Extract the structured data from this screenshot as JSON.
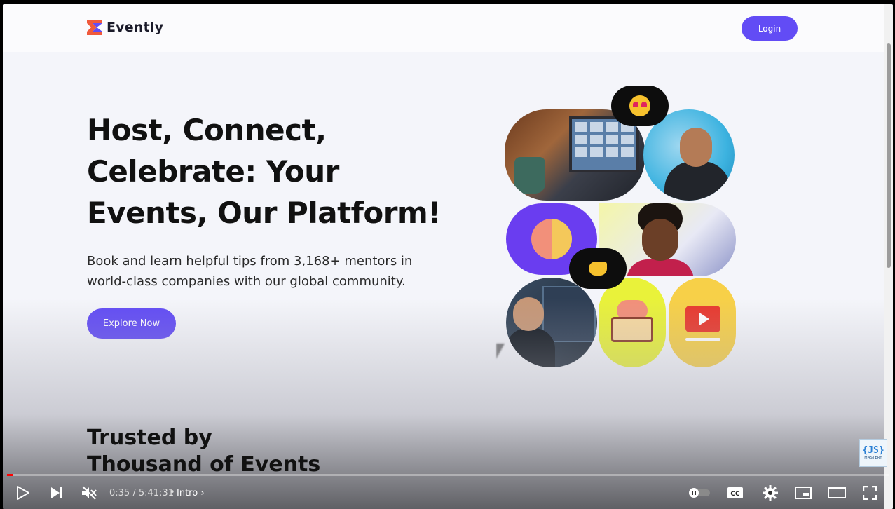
{
  "header": {
    "brand": "Evently",
    "login_label": "Login"
  },
  "hero": {
    "title": "Host, Connect, Celebrate: Your Events, Our Platform!",
    "subtitle": "Book and learn helpful tips from 3,168+ mentors in world-class companies with our global community.",
    "cta_label": "Explore Now"
  },
  "section": {
    "trusted_line1": "Trusted by",
    "trusted_line2": "Thousand of Events"
  },
  "watermark": {
    "main": "{JS}",
    "sub": "MASTERY"
  },
  "player": {
    "current_time": "0:35",
    "duration": "5:41:31",
    "time_sep": " / ",
    "chapter_sep": "•",
    "chapter": "Intro",
    "progress_fraction": 0.0017
  },
  "colors": {
    "accent": "#624cf5",
    "progress": "#ff0000"
  }
}
